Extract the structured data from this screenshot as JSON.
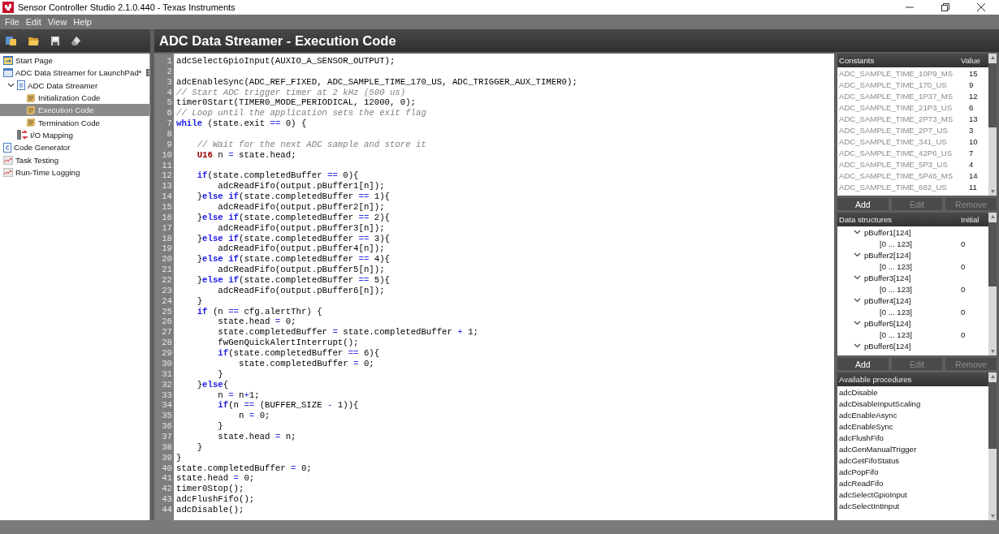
{
  "window": {
    "title": "Sensor Controller Studio 2.1.0.440 - Texas Instruments"
  },
  "menu": [
    "File",
    "Edit",
    "View",
    "Help"
  ],
  "toolbar": [
    {
      "kind": "new"
    },
    {
      "kind": "open"
    },
    {
      "kind": "save"
    },
    {
      "kind": "clean"
    }
  ],
  "sidebar": {
    "items": [
      {
        "label": "Start Page",
        "kind": "start",
        "selected": false
      },
      {
        "label": "ADC Data Streamer for LaunchPad*",
        "kind": "project",
        "selected": false,
        "children": [
          {
            "label": "ADC Data Streamer",
            "kind": "task",
            "selected": false,
            "expanded": true,
            "children": [
              {
                "label": "Initialization Code",
                "kind": "code",
                "selected": false
              },
              {
                "label": "Execution Code",
                "kind": "code",
                "selected": true
              },
              {
                "label": "Termination Code",
                "kind": "code",
                "selected": false
              }
            ]
          },
          {
            "label": "I/O Mapping",
            "kind": "io",
            "selected": false
          }
        ]
      },
      {
        "label": "Code Generator",
        "kind": "generator",
        "selected": false
      },
      {
        "label": "Task Testing",
        "kind": "chart",
        "selected": false
      },
      {
        "label": "Run-Time Logging",
        "kind": "chart",
        "selected": false
      }
    ]
  },
  "editor": {
    "title": "ADC Data Streamer - Execution Code",
    "lines": [
      {
        "number": "1",
        "tokens": [
          {
            "kind": "plain",
            "text": "adcSelectGpioInput(AUXIO_A_SENSOR_OUTPUT);"
          }
        ]
      },
      {
        "number": "2"
      },
      {
        "number": "3",
        "tokens": [
          {
            "kind": "plain",
            "text": "adcEnableSync(ADC_REF_FIXED, ADC_SAMPLE_TIME_170_US, ADC_TRIGGER_AUX_TIMER0);"
          }
        ]
      },
      {
        "number": "4",
        "tokens": [
          {
            "kind": "comment",
            "text": "// Start ADC trigger timer at 2 kHz (500 us)"
          }
        ]
      },
      {
        "number": "5",
        "tokens": [
          {
            "kind": "plain",
            "text": "timer0Start(TIMER0_MODE_PERIODICAL, 12000, 0);"
          }
        ]
      },
      {
        "number": "6",
        "tokens": [
          {
            "kind": "comment",
            "text": "// Loop until the application sets the exit flag"
          }
        ]
      },
      {
        "number": "7",
        "tokens": [
          {
            "kind": "keyword",
            "text": "while"
          },
          {
            "kind": "plain",
            "text": " (state.exit "
          },
          {
            "kind": "op",
            "text": "=="
          },
          {
            "kind": "plain",
            "text": " 0) {"
          }
        ]
      },
      {
        "number": "8"
      },
      {
        "number": "9",
        "tokens": [
          {
            "kind": "comment",
            "text": "    // Wait for the next ADC sample and store it"
          }
        ]
      },
      {
        "number": "10",
        "tokens": [
          {
            "kind": "type",
            "text": "    U16"
          },
          {
            "kind": "plain",
            "text": " n "
          },
          {
            "kind": "op",
            "text": "="
          },
          {
            "kind": "plain",
            "text": " state.head;"
          }
        ]
      },
      {
        "number": "11"
      },
      {
        "number": "12",
        "tokens": [
          {
            "kind": "keyword",
            "text": "    if"
          },
          {
            "kind": "plain",
            "text": "(state.completedBuffer "
          },
          {
            "kind": "op",
            "text": "=="
          },
          {
            "kind": "plain",
            "text": " 0){"
          }
        ]
      },
      {
        "number": "13",
        "tokens": [
          {
            "kind": "plain",
            "text": "        adcReadFifo(output.pBuffer1[n]);"
          }
        ]
      },
      {
        "number": "14",
        "tokens": [
          {
            "kind": "plain",
            "text": "    }"
          },
          {
            "kind": "keyword",
            "text": "else if"
          },
          {
            "kind": "plain",
            "text": "(state.completedBuffer "
          },
          {
            "kind": "op",
            "text": "=="
          },
          {
            "kind": "plain",
            "text": " 1){"
          }
        ]
      },
      {
        "number": "15",
        "tokens": [
          {
            "kind": "plain",
            "text": "        adcReadFifo(output.pBuffer2[n]);"
          }
        ]
      },
      {
        "number": "16",
        "tokens": [
          {
            "kind": "plain",
            "text": "    }"
          },
          {
            "kind": "keyword",
            "text": "else if"
          },
          {
            "kind": "plain",
            "text": "(state.completedBuffer "
          },
          {
            "kind": "op",
            "text": "=="
          },
          {
            "kind": "plain",
            "text": " 2){"
          }
        ]
      },
      {
        "number": "17",
        "tokens": [
          {
            "kind": "plain",
            "text": "        adcReadFifo(output.pBuffer3[n]);"
          }
        ]
      },
      {
        "number": "18",
        "tokens": [
          {
            "kind": "plain",
            "text": "    }"
          },
          {
            "kind": "keyword",
            "text": "else if"
          },
          {
            "kind": "plain",
            "text": "(state.completedBuffer "
          },
          {
            "kind": "op",
            "text": "=="
          },
          {
            "kind": "plain",
            "text": " 3){"
          }
        ]
      },
      {
        "number": "19",
        "tokens": [
          {
            "kind": "plain",
            "text": "        adcReadFifo(output.pBuffer4[n]);"
          }
        ]
      },
      {
        "number": "20",
        "tokens": [
          {
            "kind": "plain",
            "text": "    }"
          },
          {
            "kind": "keyword",
            "text": "else if"
          },
          {
            "kind": "plain",
            "text": "(state.completedBuffer "
          },
          {
            "kind": "op",
            "text": "=="
          },
          {
            "kind": "plain",
            "text": " 4){"
          }
        ]
      },
      {
        "number": "21",
        "tokens": [
          {
            "kind": "plain",
            "text": "        adcReadFifo(output.pBuffer5[n]);"
          }
        ]
      },
      {
        "number": "22",
        "tokens": [
          {
            "kind": "plain",
            "text": "    }"
          },
          {
            "kind": "keyword",
            "text": "else if"
          },
          {
            "kind": "plain",
            "text": "(state.completedBuffer "
          },
          {
            "kind": "op",
            "text": "=="
          },
          {
            "kind": "plain",
            "text": " 5){"
          }
        ]
      },
      {
        "number": "23",
        "tokens": [
          {
            "kind": "plain",
            "text": "        adcReadFifo(output.pBuffer6[n]);"
          }
        ]
      },
      {
        "number": "24",
        "tokens": [
          {
            "kind": "plain",
            "text": "    }"
          }
        ]
      },
      {
        "number": "25",
        "tokens": [
          {
            "kind": "keyword",
            "text": "    if"
          },
          {
            "kind": "plain",
            "text": " (n "
          },
          {
            "kind": "op",
            "text": "=="
          },
          {
            "kind": "plain",
            "text": " cfg.alertThr) {"
          }
        ]
      },
      {
        "number": "26",
        "tokens": [
          {
            "kind": "plain",
            "text": "        state.head "
          },
          {
            "kind": "op",
            "text": "="
          },
          {
            "kind": "plain",
            "text": " 0;"
          }
        ]
      },
      {
        "number": "27",
        "tokens": [
          {
            "kind": "plain",
            "text": "        state.completedBuffer "
          },
          {
            "kind": "op",
            "text": "="
          },
          {
            "kind": "plain",
            "text": " state.completedBuffer "
          },
          {
            "kind": "op",
            "text": "+"
          },
          {
            "kind": "plain",
            "text": " 1;"
          }
        ]
      },
      {
        "number": "28",
        "tokens": [
          {
            "kind": "plain",
            "text": "        fwGenQuickAlertInterrupt();"
          }
        ]
      },
      {
        "number": "29",
        "tokens": [
          {
            "kind": "keyword",
            "text": "        if"
          },
          {
            "kind": "plain",
            "text": "(state.completedBuffer "
          },
          {
            "kind": "op",
            "text": "=="
          },
          {
            "kind": "plain",
            "text": " 6){"
          }
        ]
      },
      {
        "number": "30",
        "tokens": [
          {
            "kind": "plain",
            "text": "            state.completedBuffer "
          },
          {
            "kind": "op",
            "text": "="
          },
          {
            "kind": "plain",
            "text": " 0;"
          }
        ]
      },
      {
        "number": "31",
        "tokens": [
          {
            "kind": "plain",
            "text": "        }"
          }
        ]
      },
      {
        "number": "32",
        "tokens": [
          {
            "kind": "plain",
            "text": "    }"
          },
          {
            "kind": "keyword",
            "text": "else"
          },
          {
            "kind": "plain",
            "text": "{"
          }
        ]
      },
      {
        "number": "33",
        "tokens": [
          {
            "kind": "plain",
            "text": "        n "
          },
          {
            "kind": "op",
            "text": "="
          },
          {
            "kind": "plain",
            "text": " n"
          },
          {
            "kind": "op",
            "text": "+"
          },
          {
            "kind": "plain",
            "text": "1;"
          }
        ]
      },
      {
        "number": "34",
        "tokens": [
          {
            "kind": "keyword",
            "text": "        if"
          },
          {
            "kind": "plain",
            "text": "(n "
          },
          {
            "kind": "op",
            "text": "=="
          },
          {
            "kind": "plain",
            "text": " (BUFFER_SIZE "
          },
          {
            "kind": "op",
            "text": "-"
          },
          {
            "kind": "plain",
            "text": " 1)){"
          }
        ]
      },
      {
        "number": "35",
        "tokens": [
          {
            "kind": "plain",
            "text": "            n "
          },
          {
            "kind": "op",
            "text": "="
          },
          {
            "kind": "plain",
            "text": " 0;"
          }
        ]
      },
      {
        "number": "36",
        "tokens": [
          {
            "kind": "plain",
            "text": "        }"
          }
        ]
      },
      {
        "number": "37",
        "tokens": [
          {
            "kind": "plain",
            "text": "        state.head "
          },
          {
            "kind": "op",
            "text": "="
          },
          {
            "kind": "plain",
            "text": " n;"
          }
        ]
      },
      {
        "number": "38",
        "tokens": [
          {
            "kind": "plain",
            "text": "    }"
          }
        ]
      },
      {
        "number": "39",
        "tokens": [
          {
            "kind": "plain",
            "text": "}"
          }
        ]
      },
      {
        "number": "40",
        "tokens": [
          {
            "kind": "plain",
            "text": "state.completedBuffer "
          },
          {
            "kind": "op",
            "text": "="
          },
          {
            "kind": "plain",
            "text": " 0;"
          }
        ]
      },
      {
        "number": "41",
        "tokens": [
          {
            "kind": "plain",
            "text": "state.head "
          },
          {
            "kind": "op",
            "text": "="
          },
          {
            "kind": "plain",
            "text": " 0;"
          }
        ]
      },
      {
        "number": "42",
        "tokens": [
          {
            "kind": "plain",
            "text": "timer0Stop();"
          }
        ]
      },
      {
        "number": "43",
        "tokens": [
          {
            "kind": "plain",
            "text": "adcFlushFifo();"
          }
        ]
      },
      {
        "number": "44",
        "tokens": [
          {
            "kind": "plain",
            "text": "adcDisable();"
          }
        ]
      }
    ]
  },
  "constants": {
    "columns": [
      "Constants",
      "Value"
    ],
    "rows": [
      {
        "name": "ADC_SAMPLE_TIME_10P9_MS",
        "value": "15"
      },
      {
        "name": "ADC_SAMPLE_TIME_170_US",
        "value": "9"
      },
      {
        "name": "ADC_SAMPLE_TIME_1P37_MS",
        "value": "12"
      },
      {
        "name": "ADC_SAMPLE_TIME_21P3_US",
        "value": "6"
      },
      {
        "name": "ADC_SAMPLE_TIME_2P73_MS",
        "value": "13"
      },
      {
        "name": "ADC_SAMPLE_TIME_2P7_US",
        "value": "3"
      },
      {
        "name": "ADC_SAMPLE_TIME_341_US",
        "value": "10"
      },
      {
        "name": "ADC_SAMPLE_TIME_42P6_US",
        "value": "7"
      },
      {
        "name": "ADC_SAMPLE_TIME_5P3_US",
        "value": "4"
      },
      {
        "name": "ADC_SAMPLE_TIME_5P46_MS",
        "value": "14"
      },
      {
        "name": "ADC_SAMPLE_TIME_682_US",
        "value": "11"
      }
    ],
    "buttons": [
      {
        "label": "Add",
        "disabled": false
      },
      {
        "label": "Edit",
        "disabled": true
      },
      {
        "label": "Remove",
        "disabled": true
      }
    ]
  },
  "data_structures": {
    "columns": [
      "Data structures",
      "Initial"
    ],
    "rows": [
      {
        "label": "pBuffer1[124]",
        "expanded": true,
        "children": [
          {
            "label": "[0 ... 123]",
            "initial": "0"
          }
        ]
      },
      {
        "label": "pBuffer2[124]",
        "expanded": true,
        "children": [
          {
            "label": "[0 ... 123]",
            "initial": "0"
          }
        ]
      },
      {
        "label": "pBuffer3[124]",
        "expanded": true,
        "children": [
          {
            "label": "[0 ... 123]",
            "initial": "0"
          }
        ]
      },
      {
        "label": "pBuffer4[124]",
        "expanded": true,
        "children": [
          {
            "label": "[0 ... 123]",
            "initial": "0"
          }
        ]
      },
      {
        "label": "pBuffer5[124]",
        "expanded": true,
        "children": [
          {
            "label": "[0 ... 123]",
            "initial": "0"
          }
        ]
      },
      {
        "label": "pBuffer6[124]",
        "expanded": true
      }
    ],
    "buttons": [
      {
        "label": "Add",
        "disabled": false
      },
      {
        "label": "Edit",
        "disabled": true
      },
      {
        "label": "Remove",
        "disabled": true
      }
    ]
  },
  "procedures": {
    "title": "Available procedures",
    "items": [
      "adcDisable",
      "adcDisableInputScaling",
      "adcEnableAsync",
      "adcEnableSync",
      "adcFlushFifo",
      "adcGenManualTrigger",
      "adcGetFifoStatus",
      "adcPopFifo",
      "adcReadFifo",
      "adcSelectGpioInput",
      "adcSelectIntInput"
    ]
  }
}
